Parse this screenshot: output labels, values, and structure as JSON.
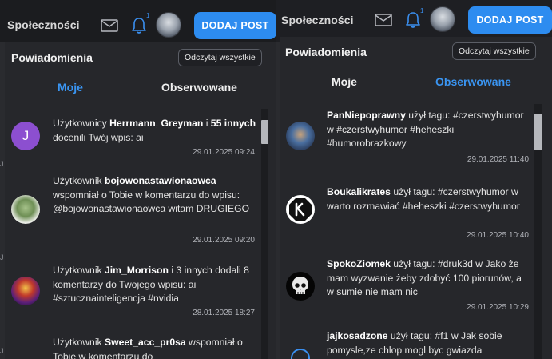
{
  "left": {
    "brand": "Społeczności",
    "bell_count": "1",
    "add_post": "DODAJ POST",
    "dropdown_title": "Powiadomienia",
    "read_all": "Odczytaj wszystkie",
    "tabs": [
      {
        "label": "Moje",
        "active": true
      },
      {
        "label": "Obserwowane",
        "active": false
      }
    ],
    "avatar_letter": "J",
    "notifications": [
      {
        "p1": "Użytkownicy ",
        "b1": "Herrmann",
        "p2": ", ",
        "b2": "Greyman",
        "p3": " i ",
        "b3": "55 innych",
        "p4": " docenili Twój wpis: ai",
        "date": "29.01.2025 09:24"
      },
      {
        "p1": "Użytkownik ",
        "b1": "bojowonastawionaowca",
        "p2": " wspomniał o Tobie w komentarzu do wpisu: @bojowonastawionaowca witam DRUGIEGO",
        "date": "29.01.2025 09:20"
      },
      {
        "p1": "Użytkownik ",
        "b1": "Jim_Morrison",
        "p2": " i 3 innych dodali 8 komentarzy do Twojego wpisu: ai #sztucznainteligencja #nvidia",
        "date": "28.01.2025 18:27"
      },
      {
        "p1": "Użytkownik ",
        "b1": "Sweet_acc_pr0sa",
        "p2": " wspomniał o Tobie w komentarzu do",
        "date": ""
      }
    ],
    "edge_letters": [
      "J",
      "J",
      "J"
    ]
  },
  "right": {
    "brand": "Społeczności",
    "bell_count": "1",
    "add_post": "DODAJ POST",
    "dropdown_title": "Powiadomienia",
    "read_all": "Odczytaj wszystkie",
    "tabs": [
      {
        "label": "Moje",
        "active": false
      },
      {
        "label": "Obserwowane",
        "active": true
      }
    ],
    "notifications": [
      {
        "b1": "PanNiepoprawny",
        "p1": " użył tagu: #czerstwyhumor w #czerstwyhumor #heheszki #humorobrazkowy",
        "date": "29.01.2025 11:40"
      },
      {
        "b1": "Boukalikrates",
        "p1": " użył tagu: #czerstwyhumor w warto rozmawiać #heheszki #czerstwyhumor",
        "date": "29.01.2025 10:40"
      },
      {
        "b1": "SpokoZiomek",
        "p1": " użył tagu: #druk3d w Jako że mam wyzwanie żeby zdobyć 100 piorunów, a w sumie nie mam nic",
        "date": "29.01.2025 10:29"
      },
      {
        "b1": "jajkosadzone",
        "p1": " użył tagu: #f1 w Jak sobie pomysle,ze chlop mogl byc gwiazda",
        "date": ""
      }
    ]
  },
  "colors": {
    "accent": "#2d8cf0",
    "tab_active": "#3a95f2",
    "panel_bg": "#26272b"
  }
}
